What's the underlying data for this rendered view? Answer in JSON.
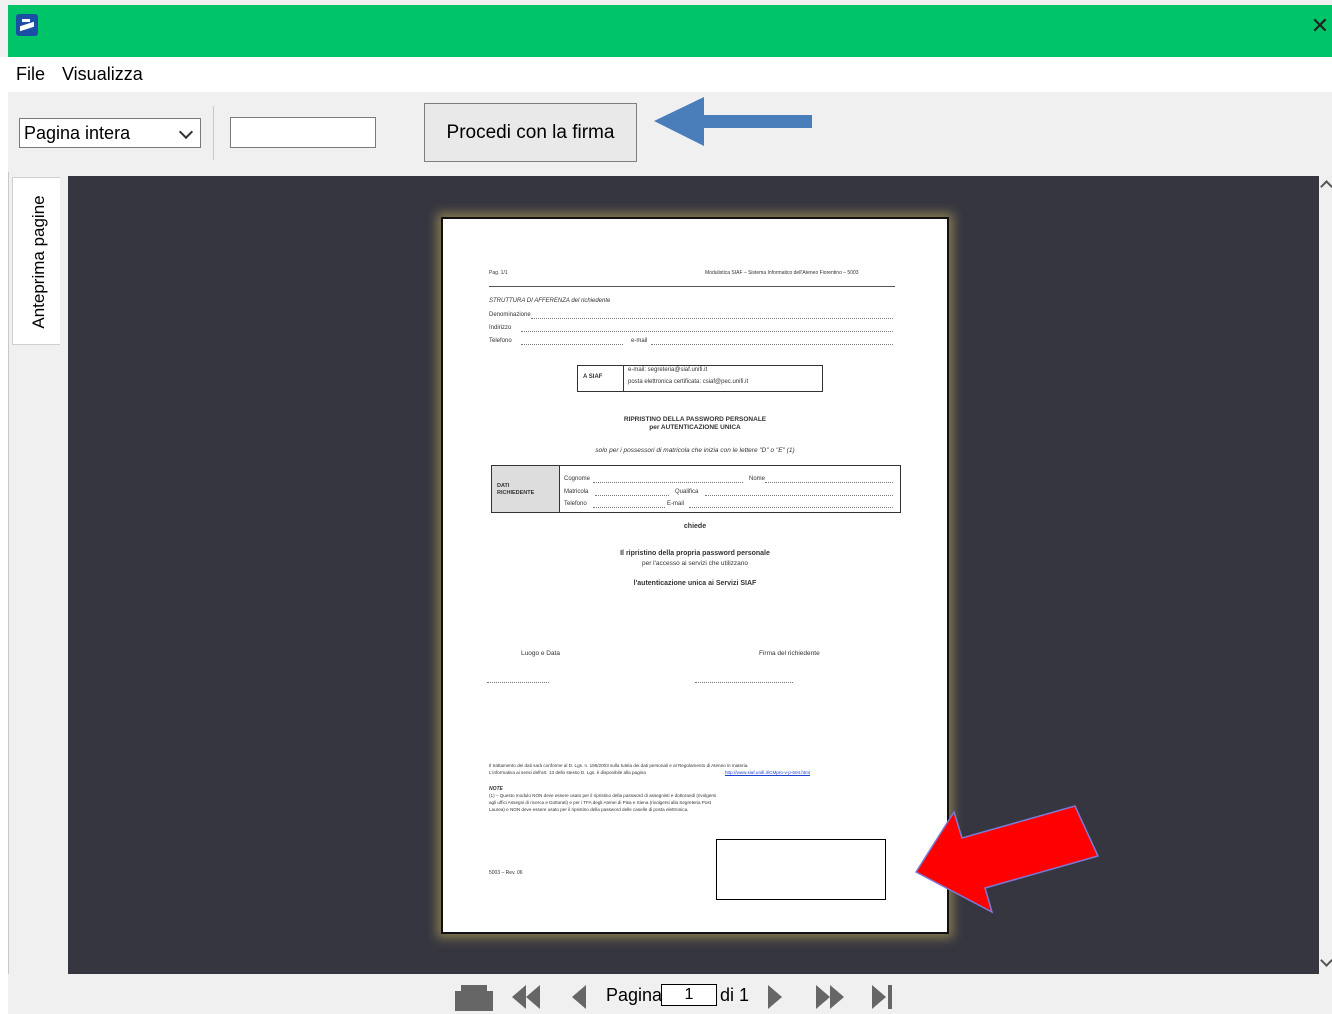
{
  "window": {
    "close_glyph": "✕",
    "icon": "siaf-app-icon"
  },
  "menu": {
    "items": [
      {
        "label": "File"
      },
      {
        "label": "Visualizza"
      }
    ]
  },
  "toolbar": {
    "zoom_value": "Pagina intera",
    "search_value": "",
    "sign_button": "Procedi con la firma"
  },
  "sidebar": {
    "tab_label": "Anteprima pagine"
  },
  "document": {
    "header_left": "Pag. 1/1",
    "header_right": "Modulistica SIAF – Sistema Informatico dell'Ateneo Fiorentino – 5003",
    "struttura": "STRUTTURA DI AFFERENZA del richiedente",
    "denominazione": "Denominazione",
    "indirizzo": "Indirizzo",
    "telefono": "Telefono",
    "email_label": "e-mail",
    "siaf_to": "A  SIAF",
    "siaf_email": "e-mail: segreteria@siaf.unifi.it",
    "siaf_pec": "posta elettronica certificata: csiaf@pec.unifi.it",
    "title1": "RIPRISTINO DELLA PASSWORD PERSONALE",
    "title2": "per AUTENTICAZIONE UNICA",
    "subtitle": "solo per i possessori di matricola che inizia con le lettere \"D\" o \"E\" (1)",
    "dati_label1": "DATI",
    "dati_label2": "RICHIEDENTE",
    "cognome": "Cognome",
    "nome": "Nome",
    "matricola": "Matricola",
    "qualifica": "Qualifica",
    "telefono2": "Telefono",
    "email2": "E-mail",
    "chiede": "chiede",
    "body1": "Il ripristino della propria password personale",
    "body2": "per l'accesso ai servizi che utilizzano",
    "body3": "l'autenticazione unica ai Servizi SIAF",
    "luogo": "Luogo e Data",
    "firma": "Firma del richiedente",
    "privacy1": "Il trattamento dei dati sarà conforme al D. Lgs. n. 196/2003 sulla tutela dei dati personali e al Regolamento di Ateneo in materia.",
    "privacy2": "L'informativa ai sensi dell'art. 13 dello stesso D. Lgs. è disponibile alla pagina",
    "privacy_link": "http://www.siaf.unifi.it/CMpro-v-p-604.html",
    "note_title": "NOTE",
    "note1": "(1) – Questo modulo NON deve essere usato per il ripristino della password di assegnisti e dottorandi (rivolgersi",
    "note2": "agli uffici Assegni di ricerca e Dottorati) e per i TFA degli Atenei di Pisa e Siena (rivolgersi alla Segreteria Post",
    "note3": "Laurea) e NON deve essere usato per il ripristino della password delle caselle di posta elettronica.",
    "footer": "5003 – Rev. 06"
  },
  "pager": {
    "label": "Pagina",
    "current": "1",
    "of": "di 1"
  },
  "annotations": {
    "blue_arrow_color": "#4a7ebb",
    "red_arrow_color": "#ff0000"
  }
}
